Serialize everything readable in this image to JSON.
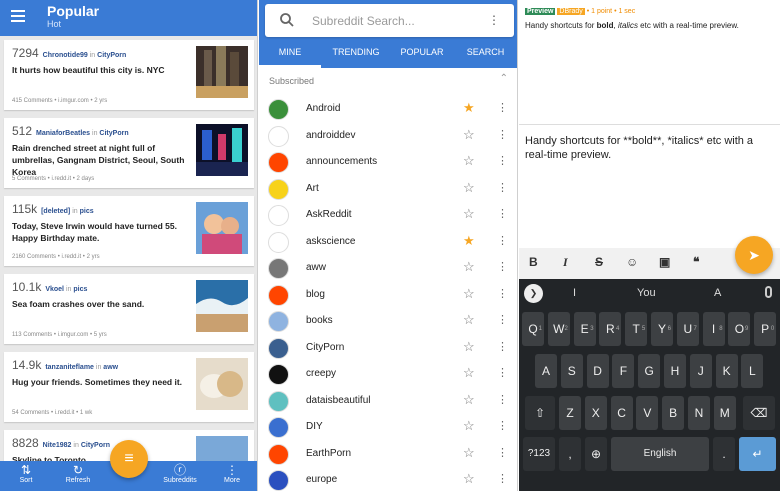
{
  "feed": {
    "title": "Popular",
    "subtitle": "Hot",
    "posts": [
      {
        "score": "7294",
        "user": "Chronotide99",
        "in": "in",
        "sub": "CityPorn",
        "title": "It hurts how beautiful this city is. NYC",
        "meta": "415 Comments • i.imgur.com • 2 yrs"
      },
      {
        "score": "512",
        "user": "ManiaforBeatles",
        "in": "in",
        "sub": "CityPorn",
        "title": "Rain drenched street at night full of umbrellas, Gangnam District, Seoul, South Korea",
        "meta": "5 Comments • i.redd.it • 2 days"
      },
      {
        "score": "115k",
        "user": "[deleted]",
        "in": "in",
        "sub": "pics",
        "title": "Today, Steve Irwin would have turned 55. Happy Birthday mate.",
        "meta": "2160 Comments • i.redd.it • 2 yrs"
      },
      {
        "score": "10.1k",
        "user": "Vkoel",
        "in": "in",
        "sub": "pics",
        "title": "Sea foam crashes over the sand.",
        "meta": "113 Comments • i.imgur.com • 5 yrs"
      },
      {
        "score": "14.9k",
        "user": "tanzaniteflame",
        "in": "in",
        "sub": "aww",
        "title": "Hug your friends. Sometimes they need it.",
        "meta": "54 Comments • i.redd.it • 1 wk"
      },
      {
        "score": "8828",
        "user": "Nite1982",
        "in": "in",
        "sub": "CityPorn",
        "title": "Skyline to Toronto",
        "meta": ""
      }
    ],
    "nav": {
      "sort": "Sort",
      "refresh": "Refresh",
      "subreddits": "Subreddits",
      "more": "More"
    }
  },
  "subreddits": {
    "search_placeholder": "Subreddit Search...",
    "tabs": [
      "MINE",
      "TRENDING",
      "POPULAR",
      "SEARCH"
    ],
    "section": "Subscribed",
    "items": [
      {
        "name": "Android",
        "fav": true,
        "color": "#3a8f3a"
      },
      {
        "name": "androiddev",
        "fav": false,
        "color": "#ffffff"
      },
      {
        "name": "announcements",
        "fav": false,
        "color": "#ff4500"
      },
      {
        "name": "Art",
        "fav": false,
        "color": "#f7d21a"
      },
      {
        "name": "AskReddit",
        "fav": false,
        "color": "#ffffff"
      },
      {
        "name": "askscience",
        "fav": true,
        "color": "#ffffff"
      },
      {
        "name": "aww",
        "fav": false,
        "color": "#777777"
      },
      {
        "name": "blog",
        "fav": false,
        "color": "#ff4500"
      },
      {
        "name": "books",
        "fav": false,
        "color": "#8fb3e0"
      },
      {
        "name": "CityPorn",
        "fav": false,
        "color": "#3a5f8f"
      },
      {
        "name": "creepy",
        "fav": false,
        "color": "#111111"
      },
      {
        "name": "dataisbeautiful",
        "fav": false,
        "color": "#5fc0c0"
      },
      {
        "name": "DIY",
        "fav": false,
        "color": "#3a6fd0"
      },
      {
        "name": "EarthPorn",
        "fav": false,
        "color": "#ff4500"
      },
      {
        "name": "europe",
        "fav": false,
        "color": "#2a4fbf"
      }
    ]
  },
  "editor": {
    "badge_preview": "Preview",
    "badge_user": "DBrady",
    "meta": "• 1 point • 1 sec",
    "preview_before": "Handy shortcuts for ",
    "preview_bold": "bold",
    "preview_mid": ", ",
    "preview_italic": "italics",
    "preview_after": " etc with a real-time preview.",
    "draft": "Handy shortcuts for **bold**, *italics* etc with a real-time preview.",
    "format_buttons": [
      "B",
      "I",
      "S",
      "☺",
      "▣",
      "❝"
    ],
    "keyboard": {
      "suggestions": [
        "I",
        "You",
        "A"
      ],
      "row1": [
        "Q",
        "W",
        "E",
        "R",
        "T",
        "Y",
        "U",
        "I",
        "O",
        "P"
      ],
      "row1_nums": [
        "1",
        "2",
        "3",
        "4",
        "5",
        "6",
        "7",
        "8",
        "9",
        "0"
      ],
      "row2": [
        "A",
        "S",
        "D",
        "F",
        "G",
        "H",
        "J",
        "K",
        "L"
      ],
      "row3": [
        "Z",
        "X",
        "C",
        "V",
        "B",
        "N",
        "M"
      ],
      "sym": "?123",
      "comma": ",",
      "space": "English",
      "period": "."
    }
  }
}
